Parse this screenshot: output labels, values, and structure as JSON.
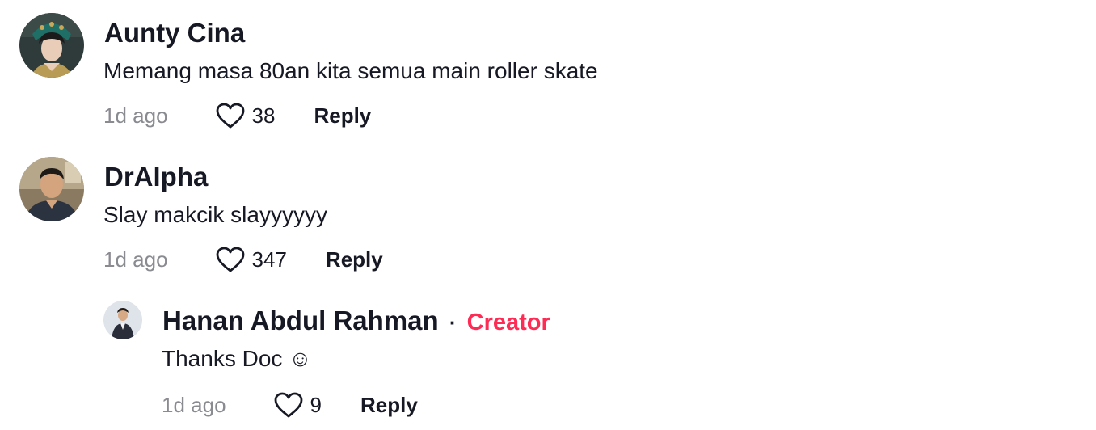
{
  "comments": [
    {
      "username": "Aunty Cina",
      "text": "Memang masa 80an kita semua main roller skate",
      "time": "1d ago",
      "likes": "38",
      "reply_label": "Reply",
      "avatar_icon": "avatar-photo"
    },
    {
      "username": "DrAlpha",
      "text": "Slay makcik slayyyyyy",
      "time": "1d ago",
      "likes": "347",
      "reply_label": "Reply",
      "avatar_icon": "avatar-photo"
    }
  ],
  "reply": {
    "username": "Hanan Abdul Rahman",
    "separator": "·",
    "badge": "Creator",
    "text": "Thanks Doc ☺",
    "time": "1d ago",
    "likes": "9",
    "reply_label": "Reply",
    "avatar_icon": "avatar-photo"
  },
  "colors": {
    "text": "#161823",
    "muted": "#8a8b91",
    "creator": "#fe2c55"
  }
}
